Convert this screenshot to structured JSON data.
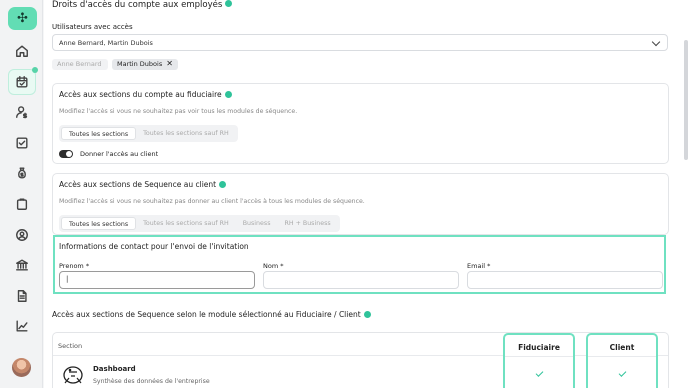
{
  "sidebar": {
    "logo_glyph": "✣",
    "items": [
      {
        "name": "home-icon"
      },
      {
        "name": "calendar-check-icon",
        "active": true
      },
      {
        "name": "user-dollar-icon"
      },
      {
        "name": "checkbox-icon"
      },
      {
        "name": "money-bag-icon"
      },
      {
        "name": "clipboard-icon"
      },
      {
        "name": "user-circle-icon"
      },
      {
        "name": "bank-icon"
      },
      {
        "name": "document-icon"
      },
      {
        "name": "chart-line-icon"
      }
    ]
  },
  "page": {
    "title": "Droits d'accès du compte aux employés"
  },
  "users": {
    "label": "Utilisateurs avec accès",
    "selected_value": "Anne Bernard, Martin Dubois",
    "chips": [
      {
        "label": "Anne Bernard",
        "active": false
      },
      {
        "label": "Martin Dubois",
        "active": true
      }
    ],
    "chip_remove_glyph": "✕"
  },
  "fiduciaire_section": {
    "title": "Accès aux sections du compte au fiduciaire",
    "description": "Modifiez l'accès si vous ne souhaitez pas voir tous les modules de séquence.",
    "options": [
      "Toutes les sections",
      "Toutes les sections sauf RH"
    ],
    "selected_index": 0,
    "toggle_label": "Donner l'accès au client",
    "toggle_on": true
  },
  "client_section": {
    "title": "Accès aux sections de Sequence au client",
    "description": "Modifiez l'accès si vous ne souhaitez pas donner au client l'accès à tous les modules de séquence.",
    "options": [
      "Toutes les sections",
      "Toutes les sections sauf RH",
      "Business",
      "RH + Business"
    ],
    "selected_index": 0
  },
  "contact": {
    "title": "Informations de contact pour l'envoi de l'invitation",
    "fields": [
      {
        "label": "Prenom *",
        "value": "|",
        "focused": true
      },
      {
        "label": "Nom *",
        "value": ""
      },
      {
        "label": "Email *",
        "value": ""
      }
    ]
  },
  "modules": {
    "title": "Accès aux sections de Sequence selon le module sélectionné au Fiduciaire / Client",
    "section_header": "Section",
    "columns": [
      "Fiduciaire",
      "Client"
    ],
    "rows": [
      {
        "name": "Dashboard",
        "description": "Synthèse des données de l'entreprise",
        "fiduciaire": true,
        "client": true
      }
    ]
  },
  "colors": {
    "accent": "#62ddb4",
    "highlight_border": "#6fe1c1",
    "help_icon": "#2fc39a"
  }
}
